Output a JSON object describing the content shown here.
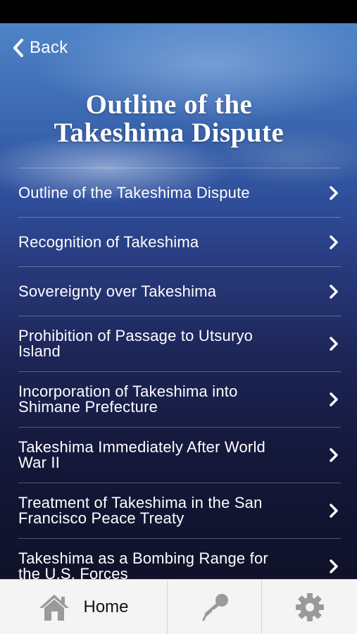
{
  "header": {
    "back_label": "Back",
    "title_line1": "Outline of the",
    "title_line2": "Takeshima Dispute"
  },
  "menu": {
    "items": [
      {
        "line1": "Outline of the Takeshima Dispute",
        "line2": ""
      },
      {
        "line1": "Recognition of Takeshima",
        "line2": ""
      },
      {
        "line1": "Sovereignty over Takeshima",
        "line2": ""
      },
      {
        "line1": "Prohibition of Passage to Utsuryo",
        "line2": "Island"
      },
      {
        "line1": "Incorporation of Takeshima into",
        "line2": "Shimane Prefecture"
      },
      {
        "line1": "Takeshima Immediately After World",
        "line2": "War II"
      },
      {
        "line1": "Treatment of Takeshima in the San",
        "line2": "Francisco Peace Treaty"
      },
      {
        "line1": "Takeshima as a Bombing Range for",
        "line2": "the U.S. Forces"
      }
    ]
  },
  "tabbar": {
    "home_label": "Home",
    "icons": [
      "home-icon",
      "microphone-icon",
      "gear-icon"
    ]
  },
  "colors": {
    "background_top": "#4f84c8",
    "background_bottom": "#0f1228",
    "tabbar_bg": "#f4f4f4",
    "tab_icon": "#9a9a9a"
  }
}
